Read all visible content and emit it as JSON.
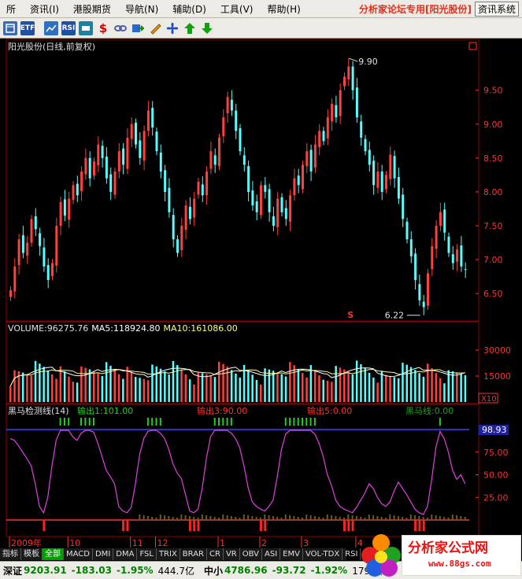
{
  "menu": {
    "items": [
      "所",
      "资讯(I)",
      "港股期货",
      "导航(N)",
      "辅助(D)",
      "工具(V)",
      "帮助(H)"
    ],
    "forum_tag": "分析家论坛专用",
    "stock_tag": "[阳光股份]",
    "news_button": "资讯系统"
  },
  "toolbar": {
    "icons": [
      "window-icon",
      "etf-icon",
      "chart-icon",
      "rsi-icon",
      "toggle-icon",
      "dollar-icon",
      "link-icon",
      "export-icon",
      "pencil-icon",
      "cross-icon",
      "up-arrow-icon",
      "down-arrow-icon"
    ],
    "labels": [
      "",
      "ETF",
      "",
      "RSI",
      "",
      "$",
      "",
      "",
      "",
      "",
      "",
      ""
    ]
  },
  "chart_data": [
    {
      "type": "candlestick",
      "title": "阳光股份(日线,前复权)",
      "ylim": [
        6.2,
        10.1
      ],
      "yticks": [
        "9.50",
        "9.00",
        "8.50",
        "8.00",
        "7.50",
        "7.00",
        "6.50"
      ],
      "annotations": [
        {
          "text": "9.90",
          "kind": "high"
        },
        {
          "text": "6.22",
          "kind": "low"
        }
      ],
      "marker": "S",
      "x_labels": [
        "2009年",
        "10",
        "11",
        "12",
        "1",
        "2",
        "3",
        "4"
      ],
      "closes": [
        6.55,
        6.9,
        7.3,
        7.1,
        7.25,
        7.6,
        7.45,
        7.2,
        6.9,
        6.7,
        6.95,
        7.5,
        7.85,
        7.65,
        7.9,
        8.1,
        7.95,
        8.3,
        8.5,
        8.2,
        8.45,
        8.7,
        8.5,
        8.2,
        8.0,
        8.3,
        8.6,
        8.4,
        8.8,
        9.0,
        8.7,
        8.5,
        8.9,
        9.2,
        8.95,
        8.6,
        8.3,
        8.0,
        7.7,
        7.3,
        7.1,
        7.5,
        7.8,
        7.6,
        7.9,
        8.15,
        7.95,
        8.3,
        8.6,
        8.4,
        8.8,
        9.1,
        9.4,
        9.2,
        8.9,
        8.6,
        8.4,
        8.0,
        7.8,
        7.7,
        8.1,
        8.0,
        7.7,
        7.5,
        7.9,
        7.7,
        7.6,
        7.95,
        8.2,
        8.1,
        8.4,
        8.6,
        8.3,
        8.7,
        8.9,
        8.75,
        9.1,
        9.3,
        9.1,
        9.5,
        9.7,
        9.85,
        9.5,
        9.1,
        8.8,
        8.6,
        8.4,
        8.1,
        8.3,
        8.0,
        8.25,
        8.55,
        8.2,
        7.9,
        7.6,
        7.3,
        7.05,
        6.7,
        6.4,
        6.3,
        6.8,
        7.2,
        7.5,
        7.7,
        7.4,
        7.1,
        6.95,
        7.15,
        6.9,
        6.85
      ],
      "volume": {
        "label": "VOLUME:96275.76",
        "ma5": "MA5:118924.80",
        "ma10": "MA10:161086.00",
        "ylim": [
          0,
          40000
        ],
        "yticks": [
          "30000",
          "15000"
        ],
        "scale": "X10"
      },
      "indicator": {
        "name": "黑马检测线(14)",
        "out1": "输出1:101.00",
        "out2": "输出3:90.00",
        "out3": "输出5:0.00",
        "out4": "黑马线:0.00",
        "top_value": "98.93",
        "yticks": [
          "75.00",
          "50.00",
          "25.00"
        ],
        "ylim": [
          0,
          100
        ],
        "values": [
          90,
          88,
          82,
          75,
          68,
          60,
          40,
          15,
          8,
          25,
          60,
          88,
          99,
          99,
          99,
          92,
          88,
          96,
          99,
          99,
          97,
          85,
          70,
          55,
          48,
          40,
          15,
          10,
          8,
          14,
          40,
          72,
          90,
          98,
          99,
          99,
          96,
          90,
          78,
          62,
          52,
          46,
          28,
          10,
          8,
          12,
          35,
          68,
          92,
          99,
          99,
          99,
          99,
          96,
          90,
          80,
          60,
          36,
          20,
          15,
          12,
          10,
          15,
          22,
          48,
          78,
          95,
          99,
          99,
          99,
          99,
          99,
          99,
          95,
          85,
          70,
          50,
          38,
          22,
          15,
          12,
          10,
          8,
          14,
          22,
          30,
          40,
          35,
          25,
          18,
          15,
          20,
          32,
          42,
          35,
          28,
          20,
          12,
          8,
          6,
          15,
          45,
          80,
          98,
          90,
          75,
          55,
          45,
          50,
          40
        ]
      }
    }
  ],
  "tabs": [
    "指标",
    "模板",
    "全部",
    "MACD",
    "DMI",
    "DMA",
    "FSL",
    "TRIX",
    "BRAR",
    "CR",
    "VR",
    "OBV",
    "ASI",
    "EMV",
    "VOL-TDX",
    "RSI"
  ],
  "status": {
    "index1_name": "深证",
    "index1_value": "9203.91",
    "index1_change": "-183.03",
    "index1_pct": "-1.95%",
    "index1_amount": "444.7亿",
    "index2_name": "中小",
    "index2_value": "4786.96",
    "index2_change": "-93.72",
    "index2_pct": "-1.92%",
    "index2_amount": "179.7亿"
  },
  "logo": {
    "title": "分析家公式网",
    "url": "www.88gs.com"
  },
  "colors": {
    "up": "#ff4040",
    "down": "#54ffff",
    "grid": "#8b0000",
    "indicator": "#e040e0",
    "axis_text": "#ff3030",
    "volume_ma": "#ffffa0"
  }
}
